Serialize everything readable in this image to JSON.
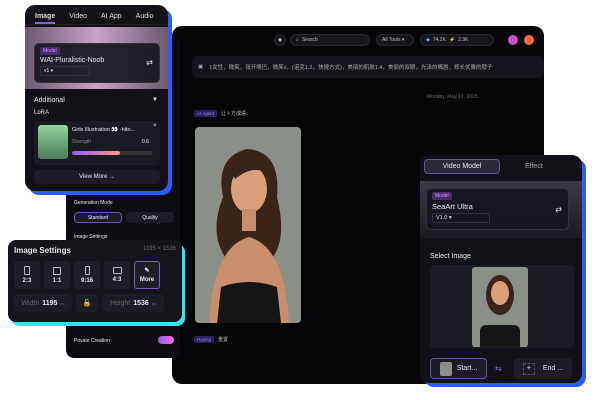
{
  "left_panel": {
    "tabs": [
      "Image",
      "Video",
      "AI App",
      "Audio"
    ],
    "model": {
      "badge": "Model",
      "name": "WAI-Pluralistic-Noob",
      "version": "v1"
    },
    "additional_label": "Additional",
    "lora_label": "LoRA",
    "lora": {
      "name": "Girls Illustration 👀 -hito...",
      "strength_label": "Strength",
      "strength": "0.6",
      "strength_fraction": 0.6
    },
    "view_more": "View More →"
  },
  "side_column": {
    "generation_mode_label": "Generation Mode",
    "modes": [
      "Standard",
      "Quality"
    ],
    "image_settings_label": "Image Settings",
    "image_settings_size": "1195 × 1536",
    "private_creation_label": "Private Creation",
    "private_creation_on": true
  },
  "image_settings": {
    "title": "Image Settings",
    "size": "1195 × 1536",
    "ratios": [
      "2:3",
      "1:1",
      "9:16",
      "4:3",
      "More"
    ],
    "width_label": "Width",
    "width": "1195",
    "height_label": "Height",
    "height": "1536",
    "unit": "px"
  },
  "main": {
    "search_placeholder": "Search",
    "all_tools": "All Tools ▾",
    "credits_a": "74.2K",
    "credits_b": "2.9K",
    "prompt": "1女性，微笑，张开嘴巴，微笑s，(诺克1.2，快捷方式)，美丽的肌肤1.4，美丽的双眼，光泽的嘴唇，修长优雅的脖子",
    "date": "Monday, May 19, 2025",
    "tag_top": "AI Agent",
    "tag_top_text": "让卜方成语",
    "tag_bottom": "Hyping",
    "tag_bottom_text": "重置"
  },
  "video_card": {
    "tabs": [
      "Video Model",
      "Effect"
    ],
    "model": {
      "badge": "Model",
      "name": "SeaArt Ultra",
      "version": "V1.0"
    },
    "select_image": "Select Image",
    "start": "Start...",
    "end": "End ..."
  },
  "colors": {
    "accent": "#8b5cf6",
    "blue": "#2a5cff",
    "cyan": "#2ee6f0"
  }
}
